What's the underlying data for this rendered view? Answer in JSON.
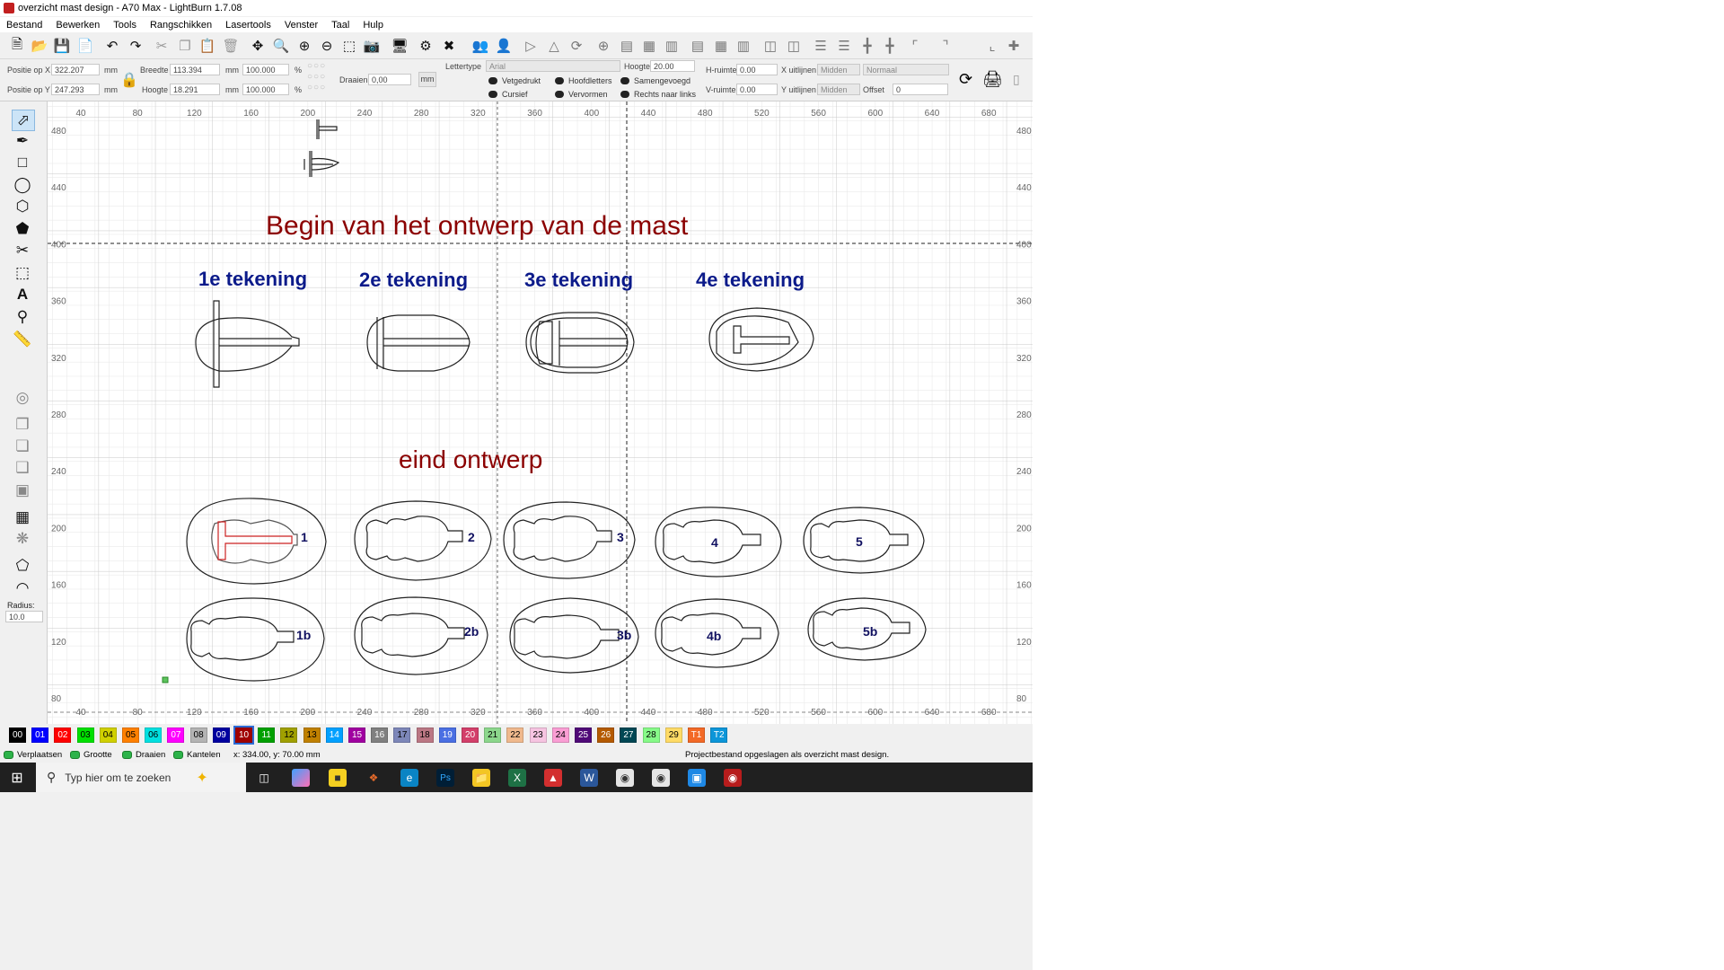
{
  "window": {
    "title": "overzicht mast design - A70 Max - LightBurn 1.7.08"
  },
  "menu": [
    "Bestand",
    "Bewerken",
    "Tools",
    "Rangschikken",
    "Lasertools",
    "Venster",
    "Taal",
    "Hulp"
  ],
  "toolbar_icons": [
    "new-file",
    "open-folder",
    "save",
    "save-as",
    "undo",
    "redo",
    "cut",
    "copy",
    "paste",
    "delete",
    "move",
    "zoom-in",
    "zoom-out",
    "zoom-minus",
    "select-frame",
    "camera",
    "monitor",
    "settings",
    "tools",
    "group",
    "user",
    "mirror-h",
    "mirror-v",
    "rotate",
    "origin",
    "align-left",
    "align-center",
    "align-right",
    "distribute",
    "more"
  ],
  "props": {
    "pos_x_label": "Positie op X",
    "pos_x_value": "322.207",
    "pos_x_unit": "mm",
    "pos_y_label": "Positie op Y",
    "pos_y_value": "247.293",
    "pos_y_unit": "mm",
    "width_label": "Breedte",
    "width_value": "113.394",
    "width_unit": "mm",
    "height_label": "Hoogte",
    "height_value": "18.291",
    "height_unit": "mm",
    "scale_x": "100.000",
    "scale_y": "100.000",
    "percent": "%",
    "rotate_label": "Draaien",
    "rotate_value": "0,00",
    "mm_button": "mm",
    "font_label": "Lettertype",
    "font_value": "Arial",
    "fheight_label": "Hoogte",
    "fheight_value": "20.00",
    "hspace_label": "H-ruimte",
    "hspace_value": "0.00",
    "vspace_label": "V-ruimte",
    "vspace_value": "0.00",
    "xalign_label": "X uitlijnen",
    "xalign_value": "Midden",
    "yalign_label": "Y uitlijnen",
    "yalign_value": "Midden",
    "normal_value": "Normaal",
    "offset_label": "Offset",
    "offset_value": "0",
    "bold": "Vetgedrukt",
    "italic": "Cursief",
    "caps": "Hoofdletters",
    "distort": "Vervormen",
    "merged": "Samengevoegd",
    "rtl": "Rechts naar links"
  },
  "left_tools": [
    "select-arrow",
    "pen",
    "rectangle",
    "circle",
    "polygon",
    "pentagon",
    "scissors",
    "frame",
    "text",
    "pin",
    "ruler",
    "offset",
    "boolean-union",
    "boolean-diff",
    "boolean-intersect",
    "weld",
    "grid-array",
    "circular-array",
    "rotate-shape",
    "corner"
  ],
  "radius": {
    "label": "Radius:",
    "value": "10.0"
  },
  "canvas": {
    "x_ticks": [
      "40",
      "80",
      "120",
      "160",
      "200",
      "240",
      "280",
      "320",
      "360",
      "400",
      "440",
      "480",
      "520",
      "560",
      "600",
      "640",
      "680"
    ],
    "y_ticks": [
      "480",
      "440",
      "400",
      "360",
      "320",
      "280",
      "240",
      "200",
      "160",
      "120",
      "80"
    ],
    "title_text": "Begin van het ontwerp van de mast",
    "drawing_labels": [
      "1e tekening",
      "2e tekening",
      "3e tekening",
      "4e tekening"
    ],
    "final_text": "eind ontwerp",
    "row1_labels": [
      "1",
      "2",
      "3",
      "4",
      "5"
    ],
    "row2_labels": [
      "1b",
      "2b",
      "3b",
      "4b",
      "5b"
    ],
    "colors": {
      "title": "#8b0000",
      "blue": "#0b1a8a",
      "label": "#101060",
      "selected": "#cc2222"
    }
  },
  "palette": [
    {
      "label": "00",
      "color": "#000000",
      "fg": "#ffffff"
    },
    {
      "label": "01",
      "color": "#0000ff",
      "fg": "#ffffff"
    },
    {
      "label": "02",
      "color": "#ff0000",
      "fg": "#ffffff"
    },
    {
      "label": "03",
      "color": "#00e000",
      "fg": "#000000"
    },
    {
      "label": "04",
      "color": "#d0d000",
      "fg": "#000000"
    },
    {
      "label": "05",
      "color": "#ff8000",
      "fg": "#000000"
    },
    {
      "label": "06",
      "color": "#00e0e0",
      "fg": "#000000"
    },
    {
      "label": "07",
      "color": "#ff00ff",
      "fg": "#ffffff"
    },
    {
      "label": "08",
      "color": "#b4b4b4",
      "fg": "#000000"
    },
    {
      "label": "09",
      "color": "#0000a0",
      "fg": "#ffffff"
    },
    {
      "label": "10",
      "color": "#a00000",
      "fg": "#ffffff"
    },
    {
      "label": "11",
      "color": "#00a000",
      "fg": "#ffffff"
    },
    {
      "label": "12",
      "color": "#a0a000",
      "fg": "#000000"
    },
    {
      "label": "13",
      "color": "#c08000",
      "fg": "#000000"
    },
    {
      "label": "14",
      "color": "#00a0ff",
      "fg": "#ffffff"
    },
    {
      "label": "15",
      "color": "#a000a0",
      "fg": "#ffffff"
    },
    {
      "label": "16",
      "color": "#808080",
      "fg": "#ffffff"
    },
    {
      "label": "17",
      "color": "#7d87b9",
      "fg": "#000000"
    },
    {
      "label": "18",
      "color": "#bb7784",
      "fg": "#000000"
    },
    {
      "label": "19",
      "color": "#4a6fe3",
      "fg": "#ffffff"
    },
    {
      "label": "20",
      "color": "#d33f6a",
      "fg": "#ffffff"
    },
    {
      "label": "21",
      "color": "#8cd78c",
      "fg": "#000000"
    },
    {
      "label": "22",
      "color": "#f0b98d",
      "fg": "#000000"
    },
    {
      "label": "23",
      "color": "#f6c4e1",
      "fg": "#000000"
    },
    {
      "label": "24",
      "color": "#fa9ed4",
      "fg": "#000000"
    },
    {
      "label": "25",
      "color": "#500a78",
      "fg": "#ffffff"
    },
    {
      "label": "26",
      "color": "#b45a00",
      "fg": "#ffffff"
    },
    {
      "label": "27",
      "color": "#004754",
      "fg": "#ffffff"
    },
    {
      "label": "28",
      "color": "#86fa88",
      "fg": "#000000"
    },
    {
      "label": "29",
      "color": "#ffdb66",
      "fg": "#000000"
    },
    {
      "label": "T1",
      "color": "#f36926",
      "fg": "#ffffff"
    },
    {
      "label": "T2",
      "color": "#0c96d9",
      "fg": "#ffffff"
    }
  ],
  "status": {
    "move": "Verplaatsen",
    "size": "Grootte",
    "rotate": "Draaien",
    "tilt": "Kantelen",
    "coords": "x: 334.00, y: 70.00 mm",
    "message": "Projectbestand opgeslagen als overzicht mast design."
  },
  "taskbar": {
    "search_placeholder": "Typ hier om te zoeken",
    "apps": [
      "task-view",
      "copilot",
      "sticky-notes",
      "app-a",
      "edge",
      "photoshop",
      "explorer",
      "excel",
      "acrobat",
      "word",
      "chrome",
      "chrome-2",
      "remote",
      "lightburn"
    ]
  }
}
